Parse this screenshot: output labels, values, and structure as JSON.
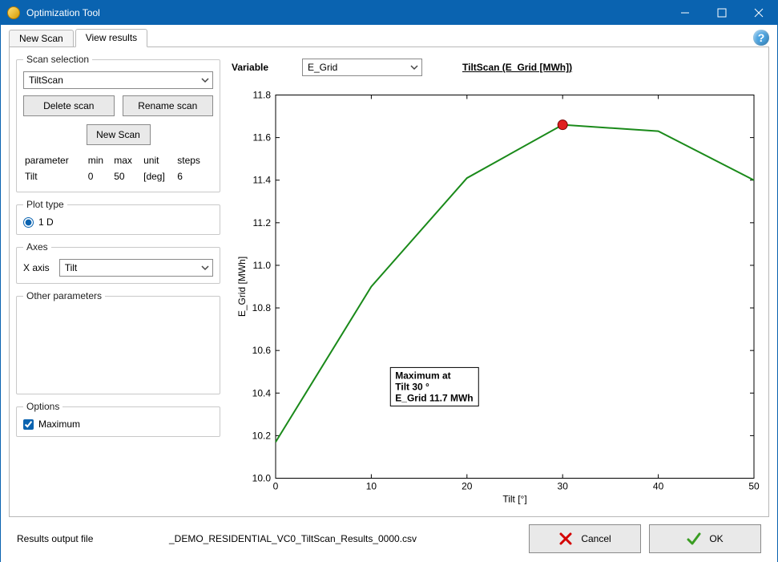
{
  "window_title": "Optimization Tool",
  "tabs": {
    "new_scan": "New Scan",
    "view_results": "View results"
  },
  "scan_selection": {
    "legend": "Scan selection",
    "selected": "TiltScan",
    "delete_btn": "Delete scan",
    "rename_btn": "Rename scan",
    "newscan_btn": "New Scan",
    "headers": {
      "parameter": "parameter",
      "min": "min",
      "max": "max",
      "unit": "unit",
      "steps": "steps"
    },
    "row": {
      "parameter": "Tilt",
      "min": "0",
      "max": "50",
      "unit": "[deg]",
      "steps": "6"
    }
  },
  "plot_type": {
    "legend": "Plot type",
    "option": "1 D"
  },
  "axes": {
    "legend": "Axes",
    "x_label": "X axis",
    "x_value": "Tilt"
  },
  "other_params": {
    "legend": "Other parameters"
  },
  "options": {
    "legend": "Options",
    "maximum": "Maximum"
  },
  "variable": {
    "label": "Variable",
    "value": "E_Grid"
  },
  "chart_title": "TiltScan (E_Grid [MWh])",
  "annotation": {
    "line1": "Maximum at",
    "line2": "Tilt 30 °",
    "line3": "E_Grid 11.7 MWh"
  },
  "footer": {
    "label": "Results output file",
    "value": "_DEMO_RESIDENTIAL_VC0_TiltScan_Results_0000.csv",
    "cancel": "Cancel",
    "ok": "OK"
  },
  "chart_data": {
    "type": "line",
    "x": [
      0,
      10,
      20,
      30,
      40,
      50
    ],
    "values": [
      10.17,
      10.9,
      11.41,
      11.66,
      11.63,
      11.4
    ],
    "marker": {
      "x": 30,
      "y": 11.66
    },
    "xlabel": "Tilt [°]",
    "ylabel": "E_Grid [MWh]",
    "xlim": [
      0,
      50
    ],
    "ylim": [
      10.0,
      11.8
    ],
    "xticks": [
      0,
      10,
      20,
      30,
      40,
      50
    ],
    "yticks": [
      10.0,
      10.2,
      10.4,
      10.6,
      10.8,
      11.0,
      11.2,
      11.4,
      11.6,
      11.8
    ]
  }
}
